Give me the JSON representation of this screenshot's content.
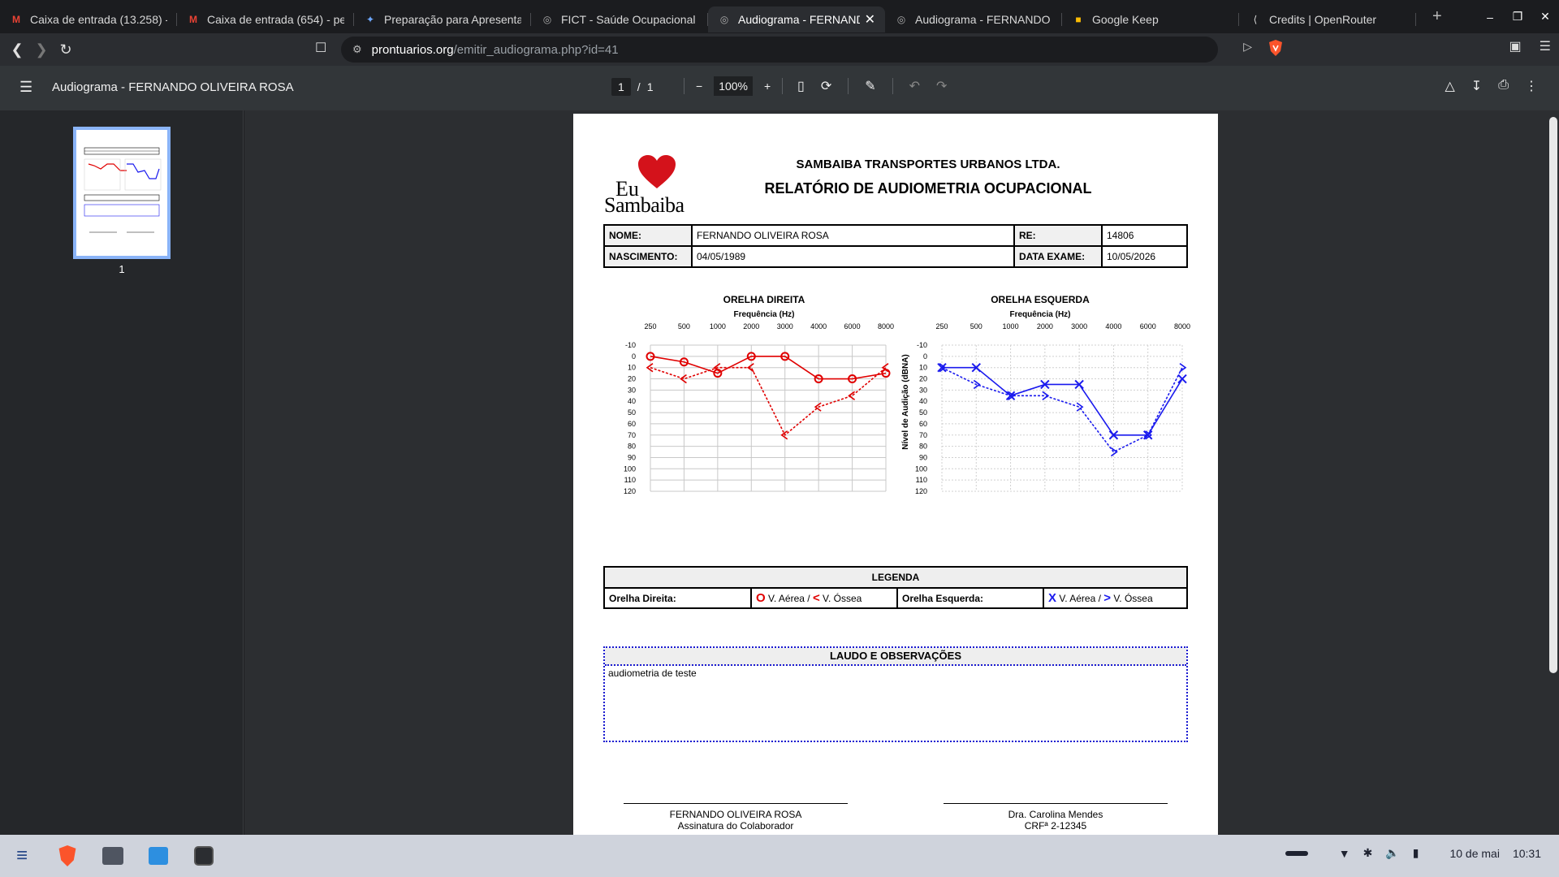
{
  "tabs": [
    {
      "title": "Caixa de entrada (13.258) -",
      "icon": "gmail-icon",
      "active": false
    },
    {
      "title": "Caixa de entrada (654) - pe",
      "icon": "gmail-icon",
      "active": false
    },
    {
      "title": "Preparação para Apresenta",
      "icon": "gemini-icon",
      "active": false
    },
    {
      "title": "FICT - Saúde Ocupacional",
      "icon": "globe-icon",
      "active": false
    },
    {
      "title": "Audiograma - FERNANDO",
      "icon": "globe-icon",
      "active": true
    },
    {
      "title": "Audiograma - FERNANDO O",
      "icon": "globe-icon",
      "active": false
    },
    {
      "title": "Google Keep",
      "icon": "keep-icon",
      "active": false
    },
    {
      "title": "Credits | OpenRouter",
      "icon": "openrouter-icon",
      "active": false
    }
  ],
  "address": {
    "host": "prontuarios.org",
    "path": "/emitir_audiograma.php?id=41"
  },
  "pdf": {
    "title": "Audiograma - FERNANDO OLIVEIRA ROSA",
    "page_current": "1",
    "page_sep": "/",
    "page_total": "1",
    "zoom": "100%",
    "thumb_label": "1"
  },
  "report": {
    "logo_line1": "Eu",
    "logo_line2": "Sambaiba",
    "company": "SAMBAIBA TRANSPORTES URBANOS LTDA.",
    "title": "RELATÓRIO DE AUDIOMETRIA OCUPACIONAL",
    "nome_label": "NOME:",
    "nome": "FERNANDO OLIVEIRA ROSA",
    "re_label": "RE:",
    "re": "14806",
    "nasc_label": "NASCIMENTO:",
    "nasc": "04/05/1989",
    "exame_label": "DATA EXAME:",
    "exame": "10/05/2026",
    "legend_title": "LEGENDA",
    "legend_right_label": "Orelha Direita:",
    "legend_right_sym_air": "O",
    "legend_right_air": " V. Aérea / ",
    "legend_right_sym_bone": "<",
    "legend_right_bone": " V. Óssea",
    "legend_left_label": "Orelha Esquerda:",
    "legend_left_sym_air": "X",
    "legend_left_air": " V. Aérea / ",
    "legend_left_sym_bone": ">",
    "legend_left_bone": " V. Óssea",
    "laudo_title": "LAUDO E OBSERVAÇÕES",
    "laudo_text": "audiometria de teste",
    "sig1_name": "FERNANDO OLIVEIRA ROSA",
    "sig1_role": "Assinatura do Colaborador",
    "sig2_name": "Dra. Carolina Mendes",
    "sig2_role": "CRFª 2-12345"
  },
  "chart_data": [
    {
      "type": "line",
      "title": "ORELHA DIREITA",
      "xlabel": "Frequência (Hz)",
      "ylabel": "",
      "categories": [
        "250",
        "500",
        "1000",
        "2000",
        "3000",
        "4000",
        "6000",
        "8000"
      ],
      "ylim": [
        -10,
        120
      ],
      "y_inverted": true,
      "yticks": [
        -10,
        0,
        10,
        20,
        30,
        40,
        50,
        60,
        70,
        80,
        90,
        100,
        110,
        120
      ],
      "color": "#e00000",
      "series": [
        {
          "name": "V. Aérea",
          "symbol": "O",
          "style": "solid",
          "values": [
            0,
            5,
            15,
            0,
            0,
            20,
            20,
            15
          ]
        },
        {
          "name": "V. Óssea",
          "symbol": "<",
          "style": "dashed",
          "values": [
            10,
            20,
            10,
            10,
            70,
            45,
            35,
            10
          ]
        }
      ]
    },
    {
      "type": "line",
      "title": "ORELHA ESQUERDA",
      "xlabel": "Frequência (Hz)",
      "ylabel": "Nível de Audição (dBNA)",
      "categories": [
        "250",
        "500",
        "1000",
        "2000",
        "3000",
        "4000",
        "6000",
        "8000"
      ],
      "ylim": [
        -10,
        120
      ],
      "y_inverted": true,
      "yticks": [
        -10,
        0,
        10,
        20,
        30,
        40,
        50,
        60,
        70,
        80,
        90,
        100,
        110,
        120
      ],
      "color": "#1a1aee",
      "series": [
        {
          "name": "V. Aérea",
          "symbol": "X",
          "style": "solid",
          "values": [
            10,
            10,
            35,
            25,
            25,
            70,
            70,
            20
          ]
        },
        {
          "name": "V. Óssea",
          "symbol": ">",
          "style": "dashed",
          "values": [
            10,
            25,
            35,
            35,
            45,
            85,
            70,
            10
          ]
        }
      ]
    }
  ],
  "taskbar": {
    "date": "10 de mai",
    "time": "10:31"
  }
}
